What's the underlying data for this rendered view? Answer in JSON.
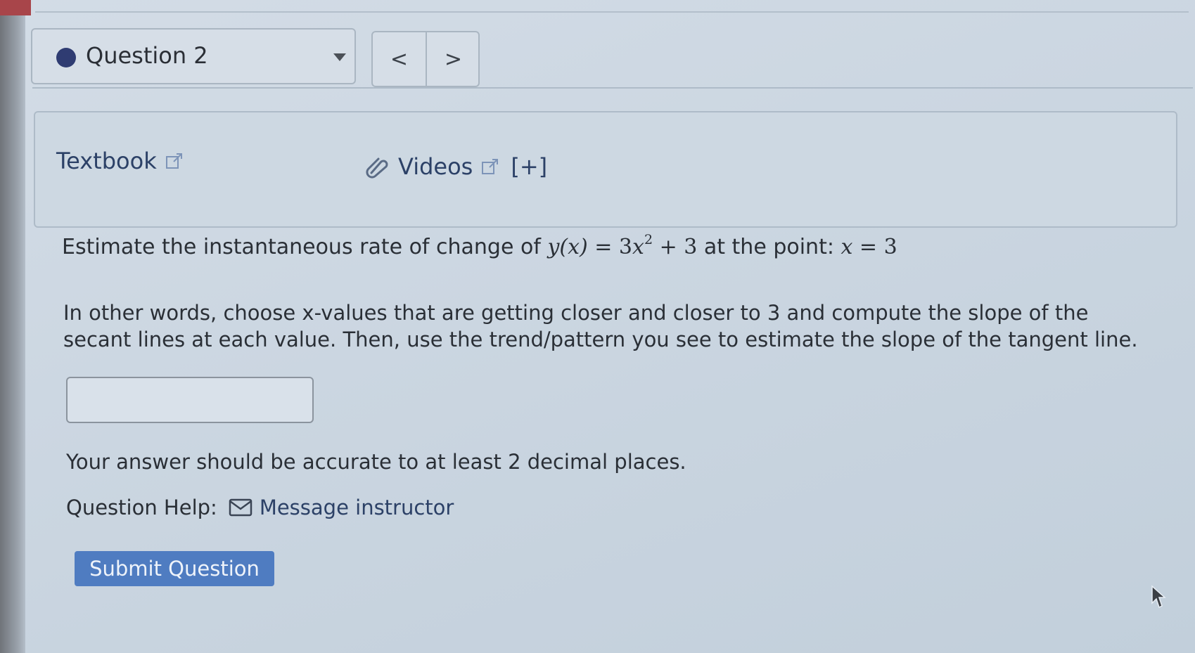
{
  "question_nav": {
    "title": "Question 2",
    "prev_symbol": "<",
    "next_symbol": ">"
  },
  "resources": {
    "textbook_label": "Textbook",
    "videos_label": "Videos",
    "expand_label": "[+]"
  },
  "problem": {
    "lead_text": "Estimate the instantaneous rate of change of ",
    "func_name": "y",
    "func_var": "(x)",
    "equals": " = 3",
    "var_x": "x",
    "exponent": "2",
    "rest": " + 3",
    "at_point": " at the point: ",
    "point_var": "x",
    "point_value": " = 3",
    "instructions": "In other words, choose x-values that are getting closer and closer to 3 and compute the slope of the secant lines at each value. Then, use the trend/pattern you see to estimate the slope of the tangent line."
  },
  "answer": {
    "value": "",
    "placeholder": ""
  },
  "accuracy_note": "Your answer should be accurate to at least 2 decimal places.",
  "help": {
    "label": "Question Help:",
    "message_label": "Message instructor"
  },
  "submit_label": "Submit Question",
  "colors": {
    "accent": "#4f7cc1",
    "link": "#2c4167",
    "status_dot": "#2f3c72"
  }
}
